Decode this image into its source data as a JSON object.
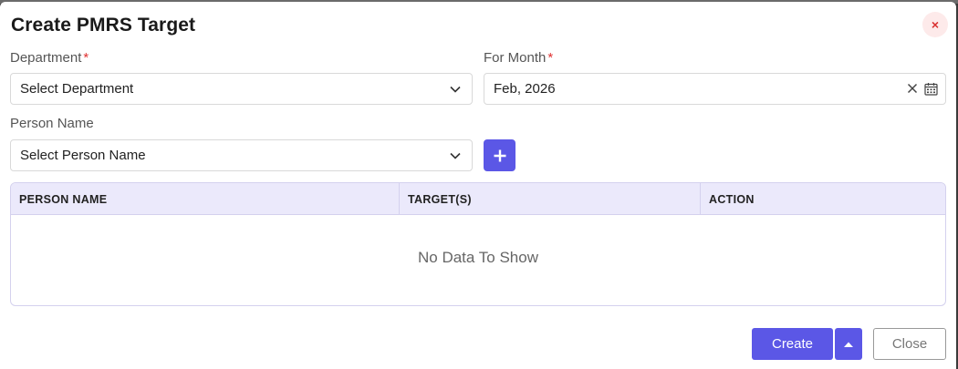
{
  "modal": {
    "title": "Create PMRS Target",
    "close_icon": "×"
  },
  "department": {
    "label": "Department",
    "required": "*",
    "value": "Select Department"
  },
  "for_month": {
    "label": "For Month",
    "required": "*",
    "value": "Feb, 2026"
  },
  "person_name": {
    "label": "Person Name",
    "value": "Select Person Name"
  },
  "table": {
    "columns": [
      "PERSON NAME",
      "TARGET(S)",
      "ACTION"
    ],
    "empty_text": "No Data To Show"
  },
  "footer": {
    "create_label": "Create",
    "close_label": "Close"
  },
  "colors": {
    "accent": "#5b57e6",
    "header_bg": "#ebe9fb",
    "required": "#e03131"
  }
}
